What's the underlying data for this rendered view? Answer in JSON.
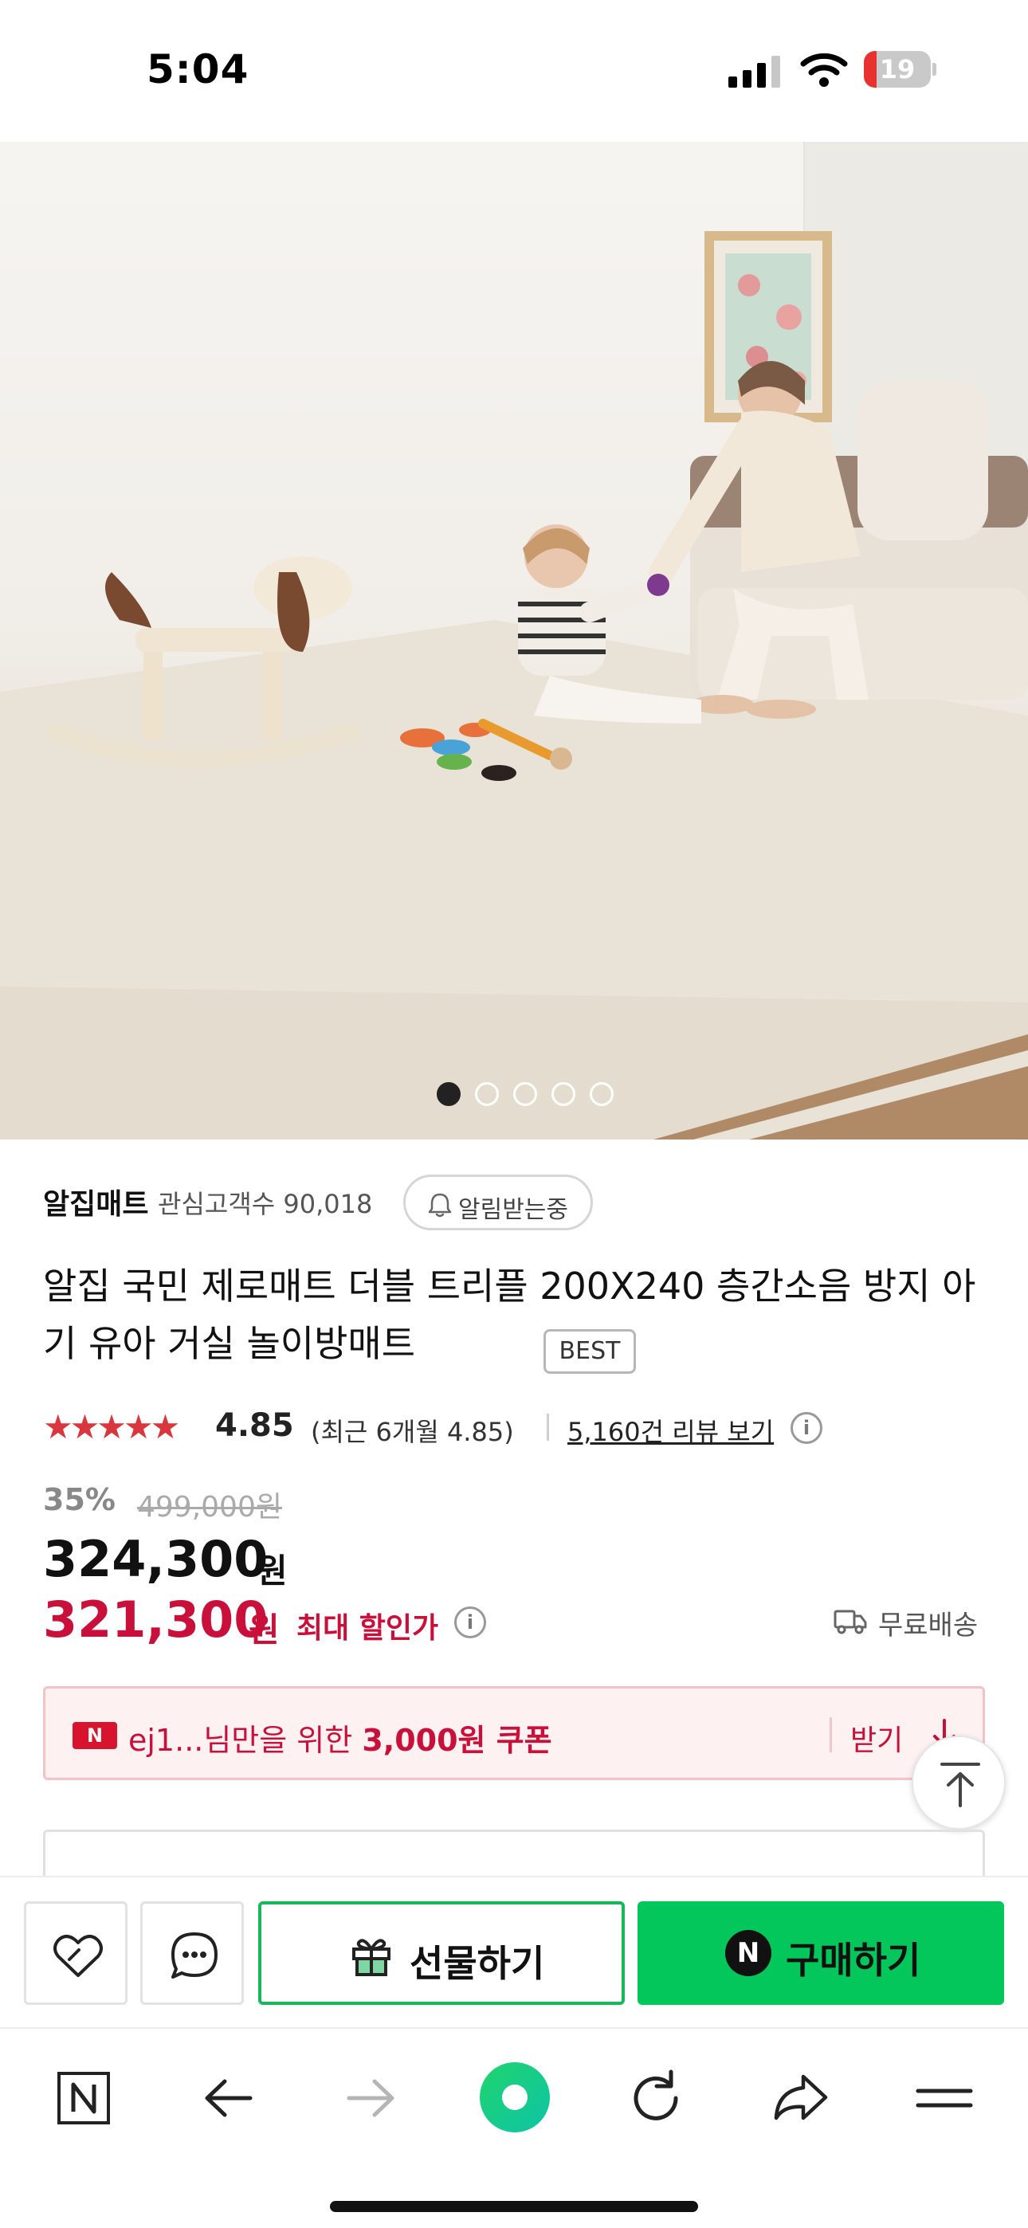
{
  "status_bar": {
    "time": "5:04",
    "battery_level": "19",
    "battery_fraction": 0.19
  },
  "gallery": {
    "image_count": 5,
    "active_index": 0,
    "expand_icon": "expand-diagonal-icon"
  },
  "store": {
    "name": "알집매트",
    "fans": "관심고객수 90,018",
    "notify_label": "알림받는중"
  },
  "product": {
    "title": "알집 국민 제로매트 더블 트리플 200X240 층간소음 방지 아기 유아 거실 놀이방매트",
    "badge": "BEST",
    "stars": "★★★★★",
    "rating": "4.85",
    "rating_recent": "(최근 6개월 4.85)",
    "reviews_link": "5,160건 리뷰 보기",
    "info_glyph": "i",
    "discount_rate": "35%",
    "original_price": "499,000원",
    "price": "324,300",
    "price_unit": "원",
    "max_discount_price": "321,300",
    "max_discount_unit": "원",
    "max_discount_label": "최대 할인가",
    "shipping": "무료배송"
  },
  "coupon": {
    "pay_logo": "N",
    "text_prefix": "ej1...님만을 위한 ",
    "text_amount": "3,000원 쿠폰",
    "receive_label": "받기"
  },
  "action_bar": {
    "gift_label": "선물하기",
    "buy_logo": "N",
    "buy_label": "구매하기"
  },
  "colors": {
    "accent_red": "#c8103a",
    "naver_green": "#03c75a",
    "star_red": "#d9363e"
  }
}
